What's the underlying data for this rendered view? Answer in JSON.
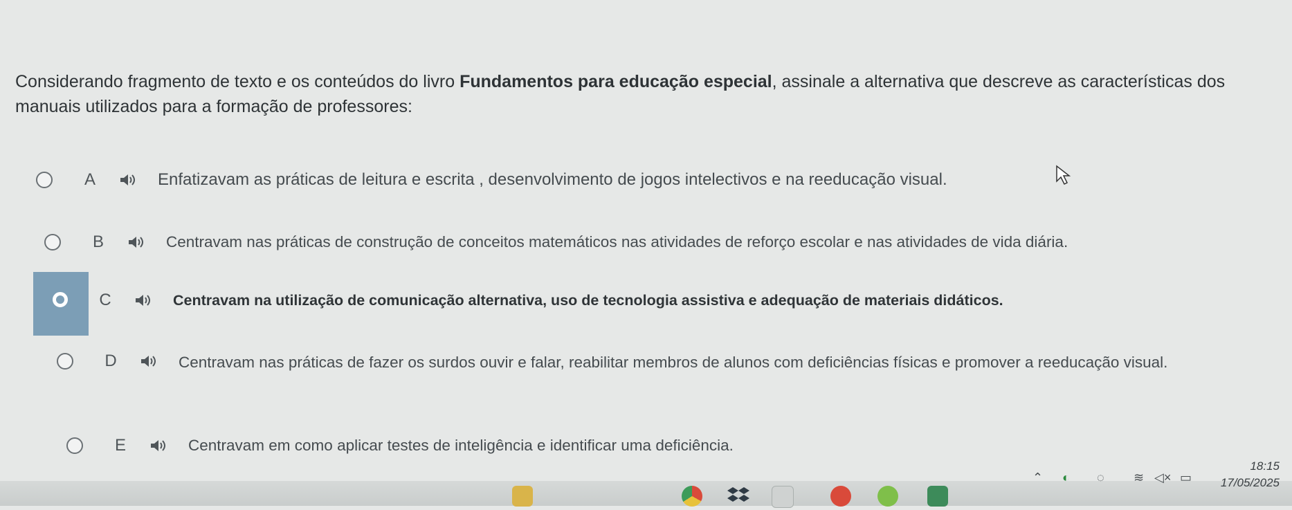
{
  "question": {
    "prefix": "Considerando fragmento de texto e os conteúdos do livro ",
    "book_title": "Fundamentos para educação especial",
    "suffix": ", assinale a alternativa que descreve as características dos manuais utilizados para a formação de professores:"
  },
  "options": [
    {
      "letter": "A",
      "text": "Enfatizavam as práticas de leitura e escrita , desenvolvimento de jogos intelectivos e na reeducação visual.",
      "selected": false
    },
    {
      "letter": "B",
      "text": "Centravam nas práticas de construção de conceitos matemáticos nas atividades de reforço escolar e nas atividades de vida diária.",
      "selected": false
    },
    {
      "letter": "C",
      "text": "Centravam na utilização de comunicação alternativa, uso de tecnologia assistiva e adequação de materiais didáticos.",
      "selected": true
    },
    {
      "letter": "D",
      "text": "Centravam nas práticas de fazer os surdos ouvir e falar, reabilitar membros de alunos com deficiências físicas e promover a reeducação visual.",
      "selected": false
    },
    {
      "letter": "E",
      "text": "Centravam em como aplicar testes de inteligência e identificar uma deficiência.",
      "selected": false
    }
  ],
  "taskbar": {
    "time": "18:15",
    "date": "17/05/2025",
    "icons": [
      "file-explorer-icon",
      "dropbox-icon",
      "amazon-icon",
      "opera-icon",
      "android-icon",
      "calendar-app-icon",
      "chrome-icon"
    ],
    "accent": "#7c9eb6"
  }
}
